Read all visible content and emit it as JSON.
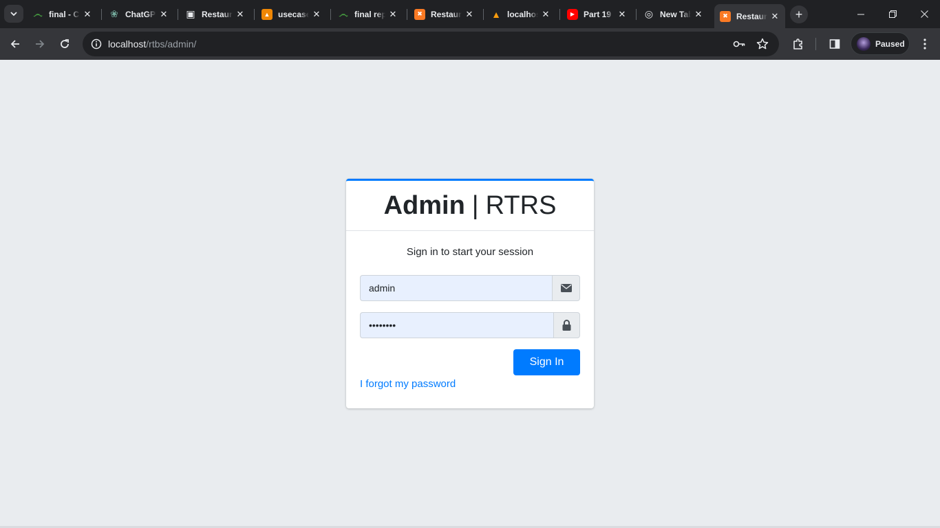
{
  "browser": {
    "tabs": [
      {
        "title": "final - C",
        "favicon": "overleaf-icon",
        "color": "#47a141"
      },
      {
        "title": "ChatGPT",
        "favicon": "chatgpt-icon",
        "color": "#74aa9c"
      },
      {
        "title": "Restaurant",
        "favicon": "restaurant-icon",
        "color": "#e8eaed"
      },
      {
        "title": "usecase",
        "favicon": "usecase-icon",
        "color": "#f08705"
      },
      {
        "title": "final report",
        "favicon": "overleaf-icon",
        "color": "#47a141"
      },
      {
        "title": "Restaurant",
        "favicon": "xampp-icon",
        "color": "#fb7a24"
      },
      {
        "title": "localhost",
        "favicon": "phpmyadmin-icon",
        "color": "#f89c0e"
      },
      {
        "title": "Part 19",
        "favicon": "youtube-icon",
        "color": "#ff0000"
      },
      {
        "title": "New Tab",
        "favicon": "chrome-icon",
        "color": "#e8eaed"
      },
      {
        "title": "Restaurant",
        "favicon": "xampp-icon",
        "color": "#fb7a24",
        "active": true
      }
    ],
    "url_host": "localhost",
    "url_path": "/rtbs/admin/",
    "profile_label": "Paused"
  },
  "login": {
    "brand_bold": "Admin",
    "brand_sep": "|",
    "brand_light": "RTRS",
    "subtitle": "Sign in to start your session",
    "username_value": "admin",
    "password_value": "••••••••",
    "signin_label": "Sign In",
    "forgot_label": "I forgot my password"
  },
  "colors": {
    "primary": "#007bff",
    "page_bg": "#e9ecef",
    "autofill_bg": "#e8f0fe"
  }
}
